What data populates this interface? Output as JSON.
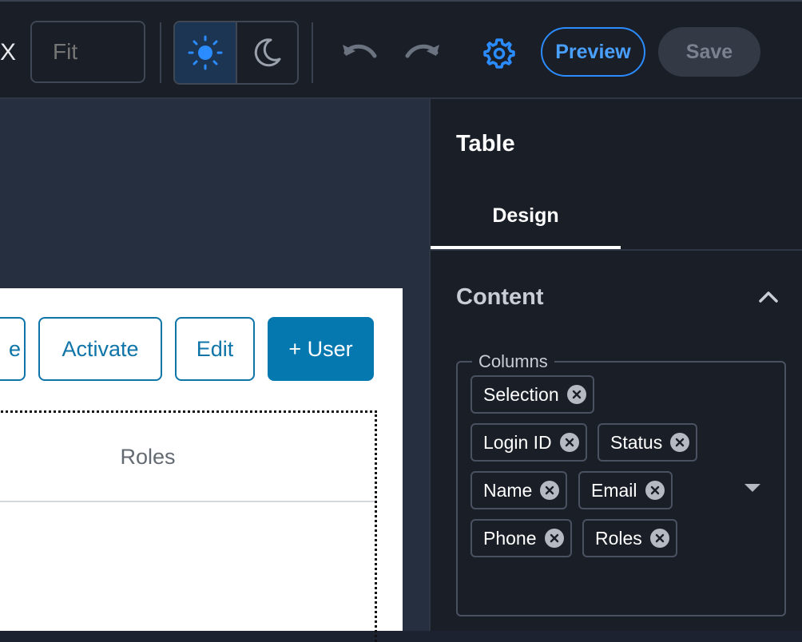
{
  "toolbar": {
    "zoom_prefix": "X",
    "zoom_placeholder": "Fit",
    "light_icon": "sun-icon",
    "dark_icon": "moon-icon",
    "undo_icon": "undo-icon",
    "redo_icon": "redo-icon",
    "settings_icon": "gear-icon",
    "preview_label": "Preview",
    "save_label": "Save",
    "colors": {
      "accent": "#2a8cff",
      "active_theme_bg": "#1c3552"
    }
  },
  "canvas": {
    "buttons": [
      {
        "label": "e"
      },
      {
        "label": "Activate"
      },
      {
        "label": "Edit"
      },
      {
        "label": "+ User"
      }
    ],
    "table": {
      "header_roles": "Roles"
    },
    "colors": {
      "primary": "#0678b0"
    }
  },
  "panel": {
    "title": "Table",
    "tab_design": "Design",
    "section_title": "Content",
    "columns_legend": "Columns",
    "columns": [
      {
        "label": "Selection"
      },
      {
        "label": "Login ID"
      },
      {
        "label": "Status"
      },
      {
        "label": "Name"
      },
      {
        "label": "Email"
      },
      {
        "label": "Phone"
      },
      {
        "label": "Roles"
      }
    ]
  }
}
